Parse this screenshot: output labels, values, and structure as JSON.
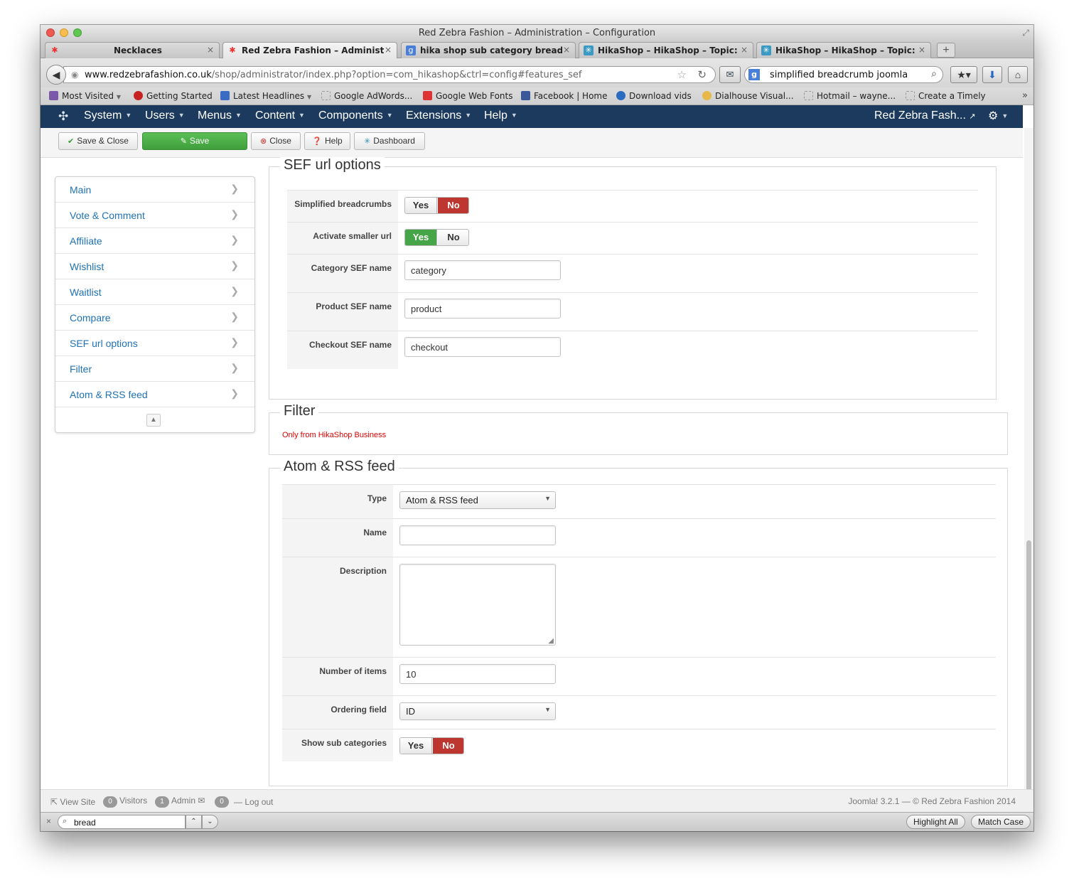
{
  "window": {
    "title": "Red Zebra Fashion – Administration – Configuration"
  },
  "tabs": [
    {
      "label": "Necklaces",
      "icon": "joomla-favicon-icon",
      "active": false
    },
    {
      "label": "Red Zebra Fashion – Administra...",
      "icon": "joomla-favicon-icon",
      "active": true
    },
    {
      "label": "hika shop sub category breadcr...",
      "icon": "google-favicon-icon",
      "active": false
    },
    {
      "label": "HikaShop – HikaShop – Topic: B...",
      "icon": "hikashop-favicon-icon",
      "active": false
    },
    {
      "label": "HikaShop – HikaShop – Topic: B...",
      "icon": "hikashop-favicon-icon",
      "active": false
    }
  ],
  "address": {
    "domain": "www.redzebrafashion.co.uk",
    "path": "/shop/administrator/index.php?option=com_hikashop&ctrl=config#features_sef"
  },
  "search": {
    "value": "simplified breadcrumb joomla"
  },
  "bookmarks": [
    {
      "label": "Most Visited",
      "icon": "most-visited-icon",
      "color": "#7a5aa8",
      "dropdown": true
    },
    {
      "label": "Getting Started",
      "icon": "firefox-icon",
      "color": "#c62222",
      "dropdown": false
    },
    {
      "label": "Latest Headlines",
      "icon": "rss-icon",
      "color": "#3a6cc4",
      "dropdown": true
    },
    {
      "label": "Google AdWords...",
      "icon": "blank-page-icon",
      "color": "#ffffff",
      "dropdown": false
    },
    {
      "label": "Google Web Fonts",
      "icon": "google-fonts-icon",
      "color": "#d33",
      "dropdown": false
    },
    {
      "label": "Facebook | Home",
      "icon": "facebook-icon",
      "color": "#3b5998",
      "dropdown": false
    },
    {
      "label": "Download vids",
      "icon": "download-vids-icon",
      "color": "#2a6ac0",
      "dropdown": false
    },
    {
      "label": "Dialhouse Visual...",
      "icon": "dialhouse-icon",
      "color": "#e6b84a",
      "dropdown": false
    },
    {
      "label": "Hotmail – wayne...",
      "icon": "blank-page-icon",
      "color": "#ffffff",
      "dropdown": false
    },
    {
      "label": "Create a Timely",
      "icon": "blank-page-icon",
      "color": "#ffffff",
      "dropdown": false
    }
  ],
  "admin_menu": {
    "items": [
      "System",
      "Users",
      "Menus",
      "Content",
      "Components",
      "Extensions",
      "Help"
    ],
    "site_name": "Red Zebra Fash...",
    "bg_color": "#1b3a5d"
  },
  "toolbar": {
    "save_close": "Save & Close",
    "save": "Save",
    "close": "Close",
    "help": "Help",
    "dashboard": "Dashboard"
  },
  "sidebar": {
    "items": [
      "Main",
      "Vote & Comment",
      "Affiliate",
      "Wishlist",
      "Waitlist",
      "Compare",
      "SEF url options",
      "Filter",
      "Atom & RSS feed"
    ]
  },
  "sef": {
    "legend": "SEF url options",
    "simplified_breadcrumbs": {
      "label": "Simplified breadcrumbs",
      "yes": "Yes",
      "no": "No",
      "value": "No"
    },
    "smaller_url": {
      "label": "Activate smaller url",
      "yes": "Yes",
      "no": "No",
      "value": "Yes"
    },
    "category_sef": {
      "label": "Category SEF name",
      "value": "category"
    },
    "product_sef": {
      "label": "Product SEF name",
      "value": "product"
    },
    "checkout_sef": {
      "label": "Checkout SEF name",
      "value": "checkout"
    }
  },
  "filter": {
    "legend": "Filter",
    "note": "Only from HikaShop Business"
  },
  "feed": {
    "legend": "Atom & RSS feed",
    "type": {
      "label": "Type",
      "value": "Atom & RSS feed"
    },
    "name": {
      "label": "Name",
      "value": ""
    },
    "description": {
      "label": "Description",
      "value": ""
    },
    "number_items": {
      "label": "Number of items",
      "value": "10"
    },
    "ordering_field": {
      "label": "Ordering field",
      "value": "ID"
    },
    "show_sub": {
      "label": "Show sub categories",
      "yes": "Yes",
      "no": "No",
      "value": "No"
    }
  },
  "status": {
    "view_site": "View Site",
    "visitors_count": "0",
    "visitors": "Visitors",
    "admin_count": "1",
    "admin": "Admin",
    "messages_count": "0",
    "logout": "Log out",
    "footer": "Joomla! 3.2.1 — © Red Zebra Fashion 2014"
  },
  "findbar": {
    "query": "bread",
    "highlight_all": "Highlight All",
    "match_case": "Match Case"
  },
  "colors": {
    "toggle_no": "#bd362f",
    "toggle_yes": "#46a546",
    "save_button": "#4cae48",
    "link": "#1f72b5",
    "note_red": "#dd0000"
  }
}
